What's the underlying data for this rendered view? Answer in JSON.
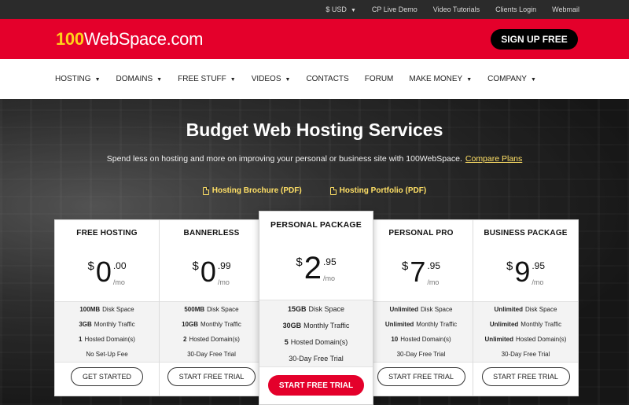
{
  "topbar": {
    "currency": "$ USD",
    "links": [
      "CP Live Demo",
      "Video Tutorials",
      "Clients Login",
      "Webmail"
    ]
  },
  "brand": {
    "logo_num": "100",
    "logo_name": "WebSpace.com",
    "signup_label": "SIGN UP FREE"
  },
  "nav": {
    "items": [
      {
        "label": "HOSTING",
        "dropdown": true
      },
      {
        "label": "DOMAINS",
        "dropdown": true
      },
      {
        "label": "FREE STUFF",
        "dropdown": true
      },
      {
        "label": "VIDEOS",
        "dropdown": true
      },
      {
        "label": "CONTACTS",
        "dropdown": false
      },
      {
        "label": "FORUM",
        "dropdown": false
      },
      {
        "label": "MAKE MONEY",
        "dropdown": true
      },
      {
        "label": "COMPANY",
        "dropdown": true
      }
    ]
  },
  "hero": {
    "title": "Budget Web Hosting Services",
    "subtitle": "Spend less on hosting and more on improving your personal or business site with 100WebSpace.",
    "compare_link": "Compare Plans",
    "brochure_link": "Hosting Brochure (PDF)",
    "portfolio_link": "Hosting Portfolio (PDF)"
  },
  "colors": {
    "brand_red": "#e4002b",
    "logo_yellow": "#ffd11a",
    "link_yellow": "#ffe066",
    "topbar_bg": "#2b2b2b"
  },
  "plans": [
    {
      "name": "FREE HOSTING",
      "currency": "$",
      "amount": "0",
      "cents": ".00",
      "period": "/mo",
      "features": [
        {
          "bold": "100MB",
          "text": "Disk Space"
        },
        {
          "bold": "3GB",
          "text": "Monthly Traffic"
        },
        {
          "bold": "1",
          "text": "Hosted Domain(s)"
        },
        {
          "bold": "",
          "text": "No Set-Up Fee"
        }
      ],
      "button": "GET STARTED"
    },
    {
      "name": "BANNERLESS",
      "currency": "$",
      "amount": "0",
      "cents": ".99",
      "period": "/mo",
      "features": [
        {
          "bold": "500MB",
          "text": "Disk Space"
        },
        {
          "bold": "10GB",
          "text": "Monthly Traffic"
        },
        {
          "bold": "2",
          "text": "Hosted Domain(s)"
        },
        {
          "bold": "",
          "text": "30-Day Free Trial"
        }
      ],
      "button": "START FREE TRIAL"
    },
    {
      "name": "PERSONAL PACKAGE",
      "currency": "$",
      "amount": "2",
      "cents": ".95",
      "period": "/mo",
      "features": [
        {
          "bold": "15GB",
          "text": "Disk Space"
        },
        {
          "bold": "30GB",
          "text": "Monthly Traffic"
        },
        {
          "bold": "5",
          "text": "Hosted Domain(s)"
        },
        {
          "bold": "",
          "text": "30-Day Free Trial"
        }
      ],
      "button": "START FREE TRIAL"
    },
    {
      "name": "PERSONAL PRO",
      "currency": "$",
      "amount": "7",
      "cents": ".95",
      "period": "/mo",
      "features": [
        {
          "bold": "Unlimited",
          "text": "Disk Space"
        },
        {
          "bold": "Unlimited",
          "text": "Monthly Traffic"
        },
        {
          "bold": "10",
          "text": "Hosted Domain(s)"
        },
        {
          "bold": "",
          "text": "30-Day Free Trial"
        }
      ],
      "button": "START FREE TRIAL"
    },
    {
      "name": "BUSINESS PACKAGE",
      "currency": "$",
      "amount": "9",
      "cents": ".95",
      "period": "/mo",
      "features": [
        {
          "bold": "Unlimited",
          "text": "Disk Space"
        },
        {
          "bold": "Unlimited",
          "text": "Monthly Traffic"
        },
        {
          "bold": "Unlimited",
          "text": "Hosted Domain(s)"
        },
        {
          "bold": "",
          "text": "30-Day Free Trial"
        }
      ],
      "button": "START FREE TRIAL"
    }
  ]
}
